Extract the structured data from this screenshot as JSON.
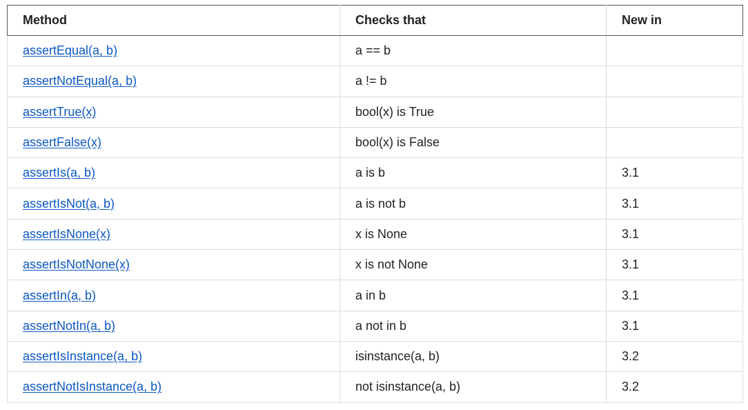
{
  "headers": {
    "method": "Method",
    "checks": "Checks that",
    "new_in": "New in"
  },
  "rows": [
    {
      "method": "assertEqual(a, b)",
      "checks": "a == b",
      "new_in": ""
    },
    {
      "method": "assertNotEqual(a, b)",
      "checks": "a != b",
      "new_in": ""
    },
    {
      "method": "assertTrue(x)",
      "checks": "bool(x) is True",
      "new_in": ""
    },
    {
      "method": "assertFalse(x)",
      "checks": "bool(x) is False",
      "new_in": ""
    },
    {
      "method": "assertIs(a, b)",
      "checks": "a is b",
      "new_in": "3.1"
    },
    {
      "method": "assertIsNot(a, b)",
      "checks": "a is not b",
      "new_in": "3.1"
    },
    {
      "method": "assertIsNone(x)",
      "checks": "x is None",
      "new_in": "3.1"
    },
    {
      "method": "assertIsNotNone(x)",
      "checks": "x is not None",
      "new_in": "3.1"
    },
    {
      "method": "assertIn(a, b)",
      "checks": "a in b",
      "new_in": "3.1"
    },
    {
      "method": "assertNotIn(a, b)",
      "checks": "a not in b",
      "new_in": "3.1"
    },
    {
      "method": "assertIsInstance(a, b)",
      "checks": "isinstance(a, b)",
      "new_in": "3.2"
    },
    {
      "method": "assertNotIsInstance(a, b)",
      "checks": "not isinstance(a, b)",
      "new_in": "3.2"
    }
  ],
  "colors": {
    "link": "#0b57c4",
    "text": "#222222",
    "border": "#dadada",
    "header_border": "#555555"
  }
}
